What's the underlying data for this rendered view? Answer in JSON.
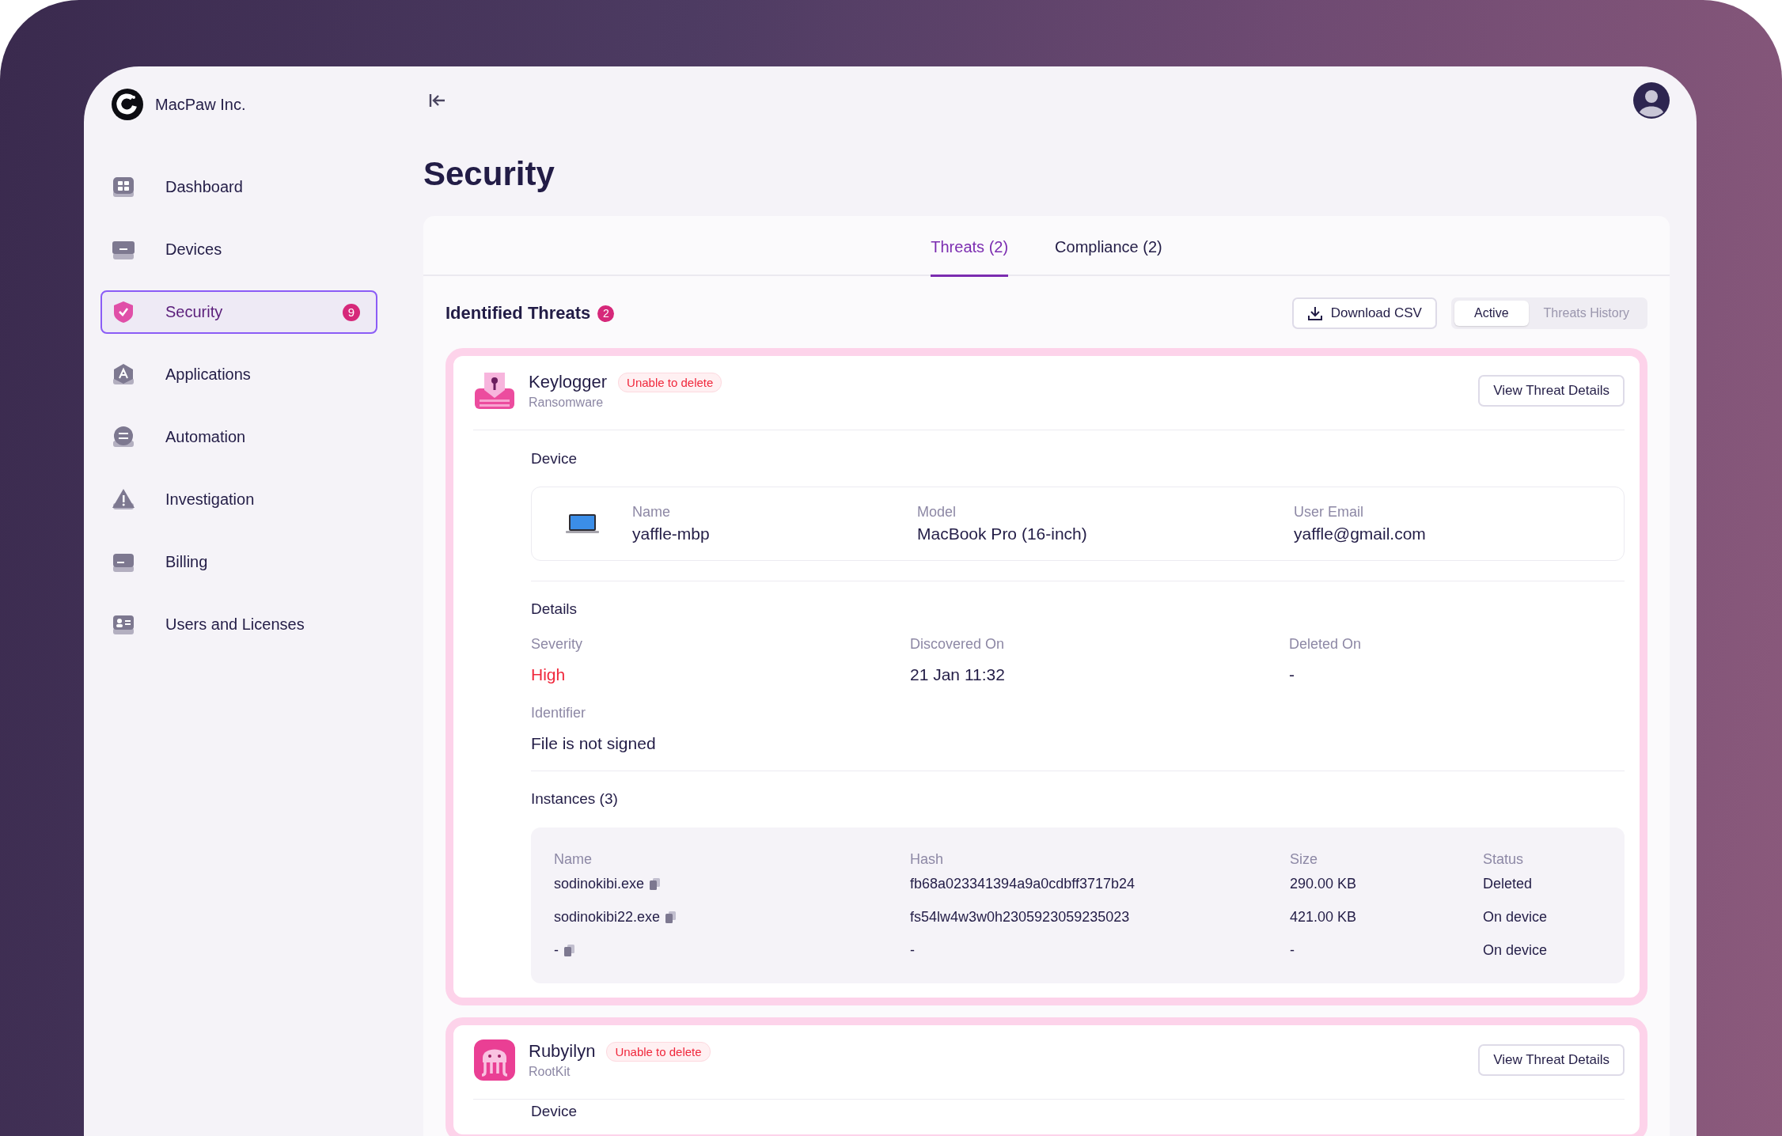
{
  "org": {
    "name": "MacPaw Inc."
  },
  "sidebar": {
    "items": [
      {
        "label": "Dashboard",
        "kind": "dashboard",
        "selected": false
      },
      {
        "label": "Devices",
        "kind": "devices",
        "selected": false
      },
      {
        "label": "Security",
        "kind": "security",
        "selected": true,
        "badge": "9"
      },
      {
        "label": "Applications",
        "kind": "applications",
        "selected": false
      },
      {
        "label": "Automation",
        "kind": "automation",
        "selected": false
      },
      {
        "label": "Investigation",
        "kind": "investigation",
        "selected": false
      },
      {
        "label": "Billing",
        "kind": "billing",
        "selected": false
      },
      {
        "label": "Users and Licenses",
        "kind": "users",
        "selected": false
      }
    ]
  },
  "page": {
    "title": "Security"
  },
  "tabs": [
    {
      "label": "Threats (2)",
      "selected": true
    },
    {
      "label": "Compliance (2)",
      "selected": false
    }
  ],
  "section": {
    "title": "Identified Threats",
    "count": "2",
    "download": "Download CSV",
    "views": [
      {
        "label": "Active",
        "selected": true
      },
      {
        "label": "Threats History",
        "selected": false
      }
    ]
  },
  "threats": [
    {
      "kind": "keyboard",
      "name": "Keylogger",
      "category": "Ransomware",
      "badge": "Unable to delete",
      "action": "View Threat Details",
      "device": {
        "title": "Device",
        "fields": [
          {
            "label": "Name",
            "value": "yaffle-mbp"
          },
          {
            "label": "Model",
            "value": "MacBook Pro (16-inch)"
          },
          {
            "label": "User Email",
            "value": "yaffle@gmail.com"
          }
        ]
      },
      "details": {
        "title": "Details",
        "fields": [
          {
            "label": "Severity",
            "value": "High",
            "kind": "danger"
          },
          {
            "label": "Discovered On",
            "value": "21 Jan 11:32",
            "kind": "plain"
          },
          {
            "label": "Deleted On",
            "value": "-",
            "kind": "plain"
          },
          {
            "label": "Identifier",
            "value": "File is not signed",
            "kind": "plain"
          }
        ]
      },
      "instances": {
        "title": "Instances (3)",
        "columns": [
          "Name",
          "Hash",
          "Size",
          "Status"
        ],
        "rows": [
          [
            "sodinokibi.exe",
            "fb68a023341394a9a0cdbff3717b24",
            "290.00 KB",
            "Deleted"
          ],
          [
            "sodinokibi22.exe",
            "fs54lw4w3w0h2305923059235023",
            "421.00 KB",
            "On device"
          ],
          [
            "-",
            "-",
            "-",
            "On device"
          ]
        ]
      }
    },
    {
      "kind": "octopus",
      "name": "Rubyilyn",
      "category": "RootKit",
      "badge": "Unable to delete",
      "action": "View Threat Details",
      "device": {
        "title": "Device"
      }
    }
  ]
}
